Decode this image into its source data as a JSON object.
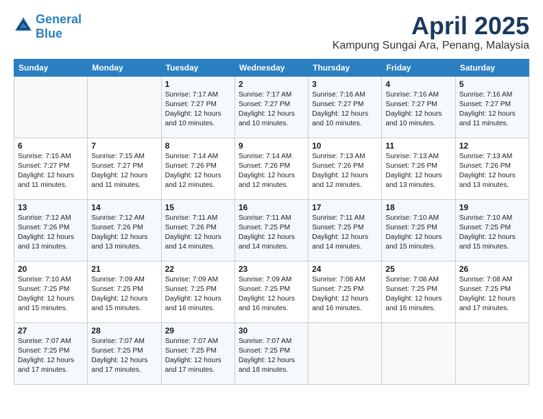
{
  "logo": {
    "line1": "General",
    "line2": "Blue"
  },
  "calendar": {
    "title": "April 2025",
    "subtitle": "Kampung Sungai Ara, Penang, Malaysia"
  },
  "headers": [
    "Sunday",
    "Monday",
    "Tuesday",
    "Wednesday",
    "Thursday",
    "Friday",
    "Saturday"
  ],
  "weeks": [
    [
      {
        "day": "",
        "info": ""
      },
      {
        "day": "",
        "info": ""
      },
      {
        "day": "1",
        "info": "Sunrise: 7:17 AM\nSunset: 7:27 PM\nDaylight: 12 hours and 10 minutes."
      },
      {
        "day": "2",
        "info": "Sunrise: 7:17 AM\nSunset: 7:27 PM\nDaylight: 12 hours and 10 minutes."
      },
      {
        "day": "3",
        "info": "Sunrise: 7:16 AM\nSunset: 7:27 PM\nDaylight: 12 hours and 10 minutes."
      },
      {
        "day": "4",
        "info": "Sunrise: 7:16 AM\nSunset: 7:27 PM\nDaylight: 12 hours and 10 minutes."
      },
      {
        "day": "5",
        "info": "Sunrise: 7:16 AM\nSunset: 7:27 PM\nDaylight: 12 hours and 11 minutes."
      }
    ],
    [
      {
        "day": "6",
        "info": "Sunrise: 7:15 AM\nSunset: 7:27 PM\nDaylight: 12 hours and 11 minutes."
      },
      {
        "day": "7",
        "info": "Sunrise: 7:15 AM\nSunset: 7:27 PM\nDaylight: 12 hours and 11 minutes."
      },
      {
        "day": "8",
        "info": "Sunrise: 7:14 AM\nSunset: 7:26 PM\nDaylight: 12 hours and 12 minutes."
      },
      {
        "day": "9",
        "info": "Sunrise: 7:14 AM\nSunset: 7:26 PM\nDaylight: 12 hours and 12 minutes."
      },
      {
        "day": "10",
        "info": "Sunrise: 7:13 AM\nSunset: 7:26 PM\nDaylight: 12 hours and 12 minutes."
      },
      {
        "day": "11",
        "info": "Sunrise: 7:13 AM\nSunset: 7:26 PM\nDaylight: 12 hours and 13 minutes."
      },
      {
        "day": "12",
        "info": "Sunrise: 7:13 AM\nSunset: 7:26 PM\nDaylight: 12 hours and 13 minutes."
      }
    ],
    [
      {
        "day": "13",
        "info": "Sunrise: 7:12 AM\nSunset: 7:26 PM\nDaylight: 12 hours and 13 minutes."
      },
      {
        "day": "14",
        "info": "Sunrise: 7:12 AM\nSunset: 7:26 PM\nDaylight: 12 hours and 13 minutes."
      },
      {
        "day": "15",
        "info": "Sunrise: 7:11 AM\nSunset: 7:26 PM\nDaylight: 12 hours and 14 minutes."
      },
      {
        "day": "16",
        "info": "Sunrise: 7:11 AM\nSunset: 7:25 PM\nDaylight: 12 hours and 14 minutes."
      },
      {
        "day": "17",
        "info": "Sunrise: 7:11 AM\nSunset: 7:25 PM\nDaylight: 12 hours and 14 minutes."
      },
      {
        "day": "18",
        "info": "Sunrise: 7:10 AM\nSunset: 7:25 PM\nDaylight: 12 hours and 15 minutes."
      },
      {
        "day": "19",
        "info": "Sunrise: 7:10 AM\nSunset: 7:25 PM\nDaylight: 12 hours and 15 minutes."
      }
    ],
    [
      {
        "day": "20",
        "info": "Sunrise: 7:10 AM\nSunset: 7:25 PM\nDaylight: 12 hours and 15 minutes."
      },
      {
        "day": "21",
        "info": "Sunrise: 7:09 AM\nSunset: 7:25 PM\nDaylight: 12 hours and 15 minutes."
      },
      {
        "day": "22",
        "info": "Sunrise: 7:09 AM\nSunset: 7:25 PM\nDaylight: 12 hours and 16 minutes."
      },
      {
        "day": "23",
        "info": "Sunrise: 7:09 AM\nSunset: 7:25 PM\nDaylight: 12 hours and 16 minutes."
      },
      {
        "day": "24",
        "info": "Sunrise: 7:08 AM\nSunset: 7:25 PM\nDaylight: 12 hours and 16 minutes."
      },
      {
        "day": "25",
        "info": "Sunrise: 7:08 AM\nSunset: 7:25 PM\nDaylight: 12 hours and 16 minutes."
      },
      {
        "day": "26",
        "info": "Sunrise: 7:08 AM\nSunset: 7:25 PM\nDaylight: 12 hours and 17 minutes."
      }
    ],
    [
      {
        "day": "27",
        "info": "Sunrise: 7:07 AM\nSunset: 7:25 PM\nDaylight: 12 hours and 17 minutes."
      },
      {
        "day": "28",
        "info": "Sunrise: 7:07 AM\nSunset: 7:25 PM\nDaylight: 12 hours and 17 minutes."
      },
      {
        "day": "29",
        "info": "Sunrise: 7:07 AM\nSunset: 7:25 PM\nDaylight: 12 hours and 17 minutes."
      },
      {
        "day": "30",
        "info": "Sunrise: 7:07 AM\nSunset: 7:25 PM\nDaylight: 12 hours and 18 minutes."
      },
      {
        "day": "",
        "info": ""
      },
      {
        "day": "",
        "info": ""
      },
      {
        "day": "",
        "info": ""
      }
    ]
  ]
}
